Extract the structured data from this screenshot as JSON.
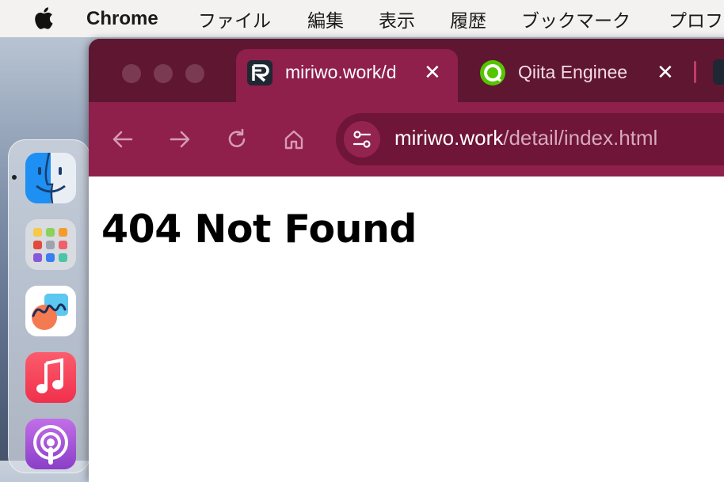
{
  "menubar": {
    "app_name": "Chrome",
    "items": [
      "ファイル",
      "編集",
      "表示",
      "履歴",
      "ブックマーク",
      "プロフ"
    ]
  },
  "tabs": [
    {
      "title": "miriwo.work/d",
      "icon": "miriwo-logo-icon",
      "active": true
    },
    {
      "title": "Qiita Enginee",
      "icon": "qiita-logo-icon",
      "active": false
    }
  ],
  "omnibox": {
    "host": "miriwo.work",
    "path": "/detail/index.html"
  },
  "page": {
    "heading": "404 Not Found"
  },
  "dock": {
    "apps": [
      "finder-icon",
      "launchpad-icon",
      "freeform-icon",
      "music-icon",
      "podcasts-icon"
    ]
  },
  "colors": {
    "tabstrip": "#5f1631",
    "toolbar": "#8f1f4b",
    "omnibox": "#6f1537"
  }
}
